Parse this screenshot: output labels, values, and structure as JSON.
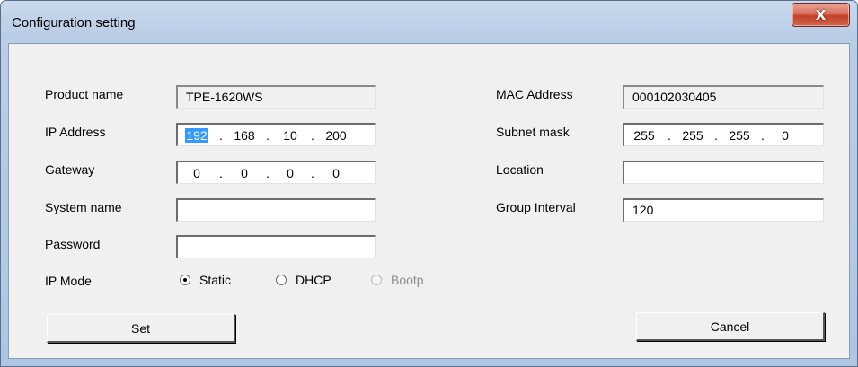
{
  "window": {
    "title": "Configuration setting",
    "close_glyph": "X"
  },
  "fields_left": {
    "product_name": {
      "label": "Product name",
      "value": "TPE-1620WS"
    },
    "ip_address": {
      "label": "IP Address",
      "octets": [
        "192",
        "168",
        "10",
        "200"
      ],
      "selected_octet": 0
    },
    "gateway": {
      "label": "Gateway",
      "octets": [
        "0",
        "0",
        "0",
        "0"
      ]
    },
    "system_name": {
      "label": "System name",
      "value": ""
    },
    "password": {
      "label": "Password",
      "value": ""
    }
  },
  "fields_right": {
    "mac_address": {
      "label": "MAC Address",
      "value": "000102030405"
    },
    "subnet_mask": {
      "label": "Subnet mask",
      "octets": [
        "255",
        "255",
        "255",
        "0"
      ]
    },
    "location": {
      "label": "Location",
      "value": ""
    },
    "group_interval": {
      "label": "Group Interval",
      "value": "120"
    }
  },
  "ip_mode": {
    "label": "IP Mode",
    "options": [
      {
        "label": "Static",
        "checked": true,
        "enabled": true
      },
      {
        "label": "DHCP",
        "checked": false,
        "enabled": true
      },
      {
        "label": "Bootp",
        "checked": false,
        "enabled": false
      }
    ]
  },
  "buttons": {
    "set": "Set",
    "cancel": "Cancel"
  },
  "ip_dot": "."
}
